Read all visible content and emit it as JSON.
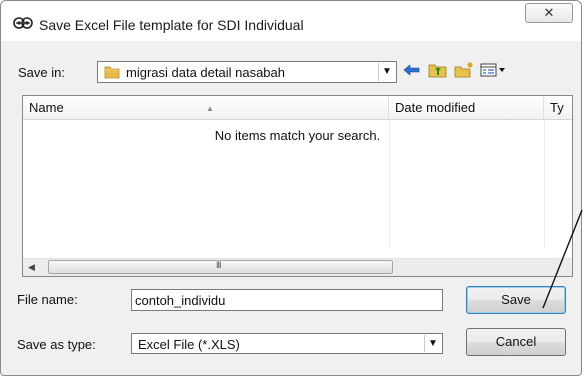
{
  "window": {
    "title": "Save Excel File template for SDI Individual",
    "close_glyph": "✕"
  },
  "toolbar": {
    "save_in_label": "Save in:",
    "save_in_value": "migrasi data detail nasabah",
    "icons": [
      "back-icon",
      "up-folder-icon",
      "new-folder-icon",
      "view-menu-icon"
    ]
  },
  "file_list": {
    "columns": [
      "Name",
      "Date modified",
      "Ty"
    ],
    "empty_message": "No items match your search.",
    "scroll_grip": "III"
  },
  "form": {
    "file_name_label": "File name:",
    "file_name_value": "contoh_individu",
    "save_as_type_label": "Save as type:",
    "save_as_type_value": "Excel File (*.XLS)"
  },
  "buttons": {
    "save": "Save",
    "cancel": "Cancel"
  },
  "colors": {
    "folder": "#e8b84a",
    "accent_border": "#3c7fb1"
  }
}
